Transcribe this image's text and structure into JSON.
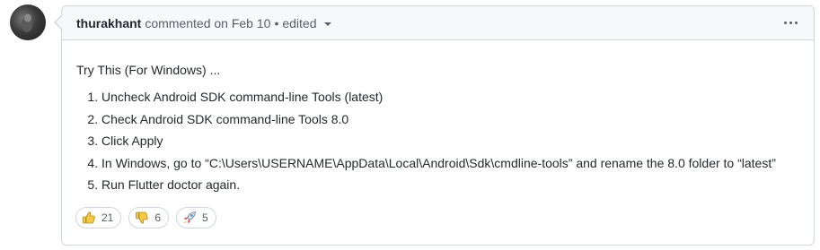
{
  "comment": {
    "author": "thurakhant",
    "action": "commented on Feb 10",
    "separator": "•",
    "edited_label": "edited"
  },
  "body": {
    "intro": "Try This (For Windows) ...",
    "steps": [
      "Uncheck Android SDK command-line Tools (latest)",
      "Check Android SDK command-line Tools 8.0",
      "Click Apply",
      "In Windows, go to “C:\\Users\\USERNAME\\AppData\\Local\\Android\\Sdk\\cmdline-tools” and rename the 8.0 folder to “latest”",
      "Run Flutter doctor again."
    ]
  },
  "reactions": [
    {
      "icon": "thumbs-up-icon",
      "count": "21"
    },
    {
      "icon": "thumbs-down-icon",
      "count": "6"
    },
    {
      "icon": "rocket-icon",
      "count": "5"
    }
  ],
  "colors": {
    "border": "#d0d7de",
    "header_bg": "#f6f8fa",
    "text": "#24292f",
    "muted": "#57606a",
    "emoji_yellow": "#f7c948"
  }
}
